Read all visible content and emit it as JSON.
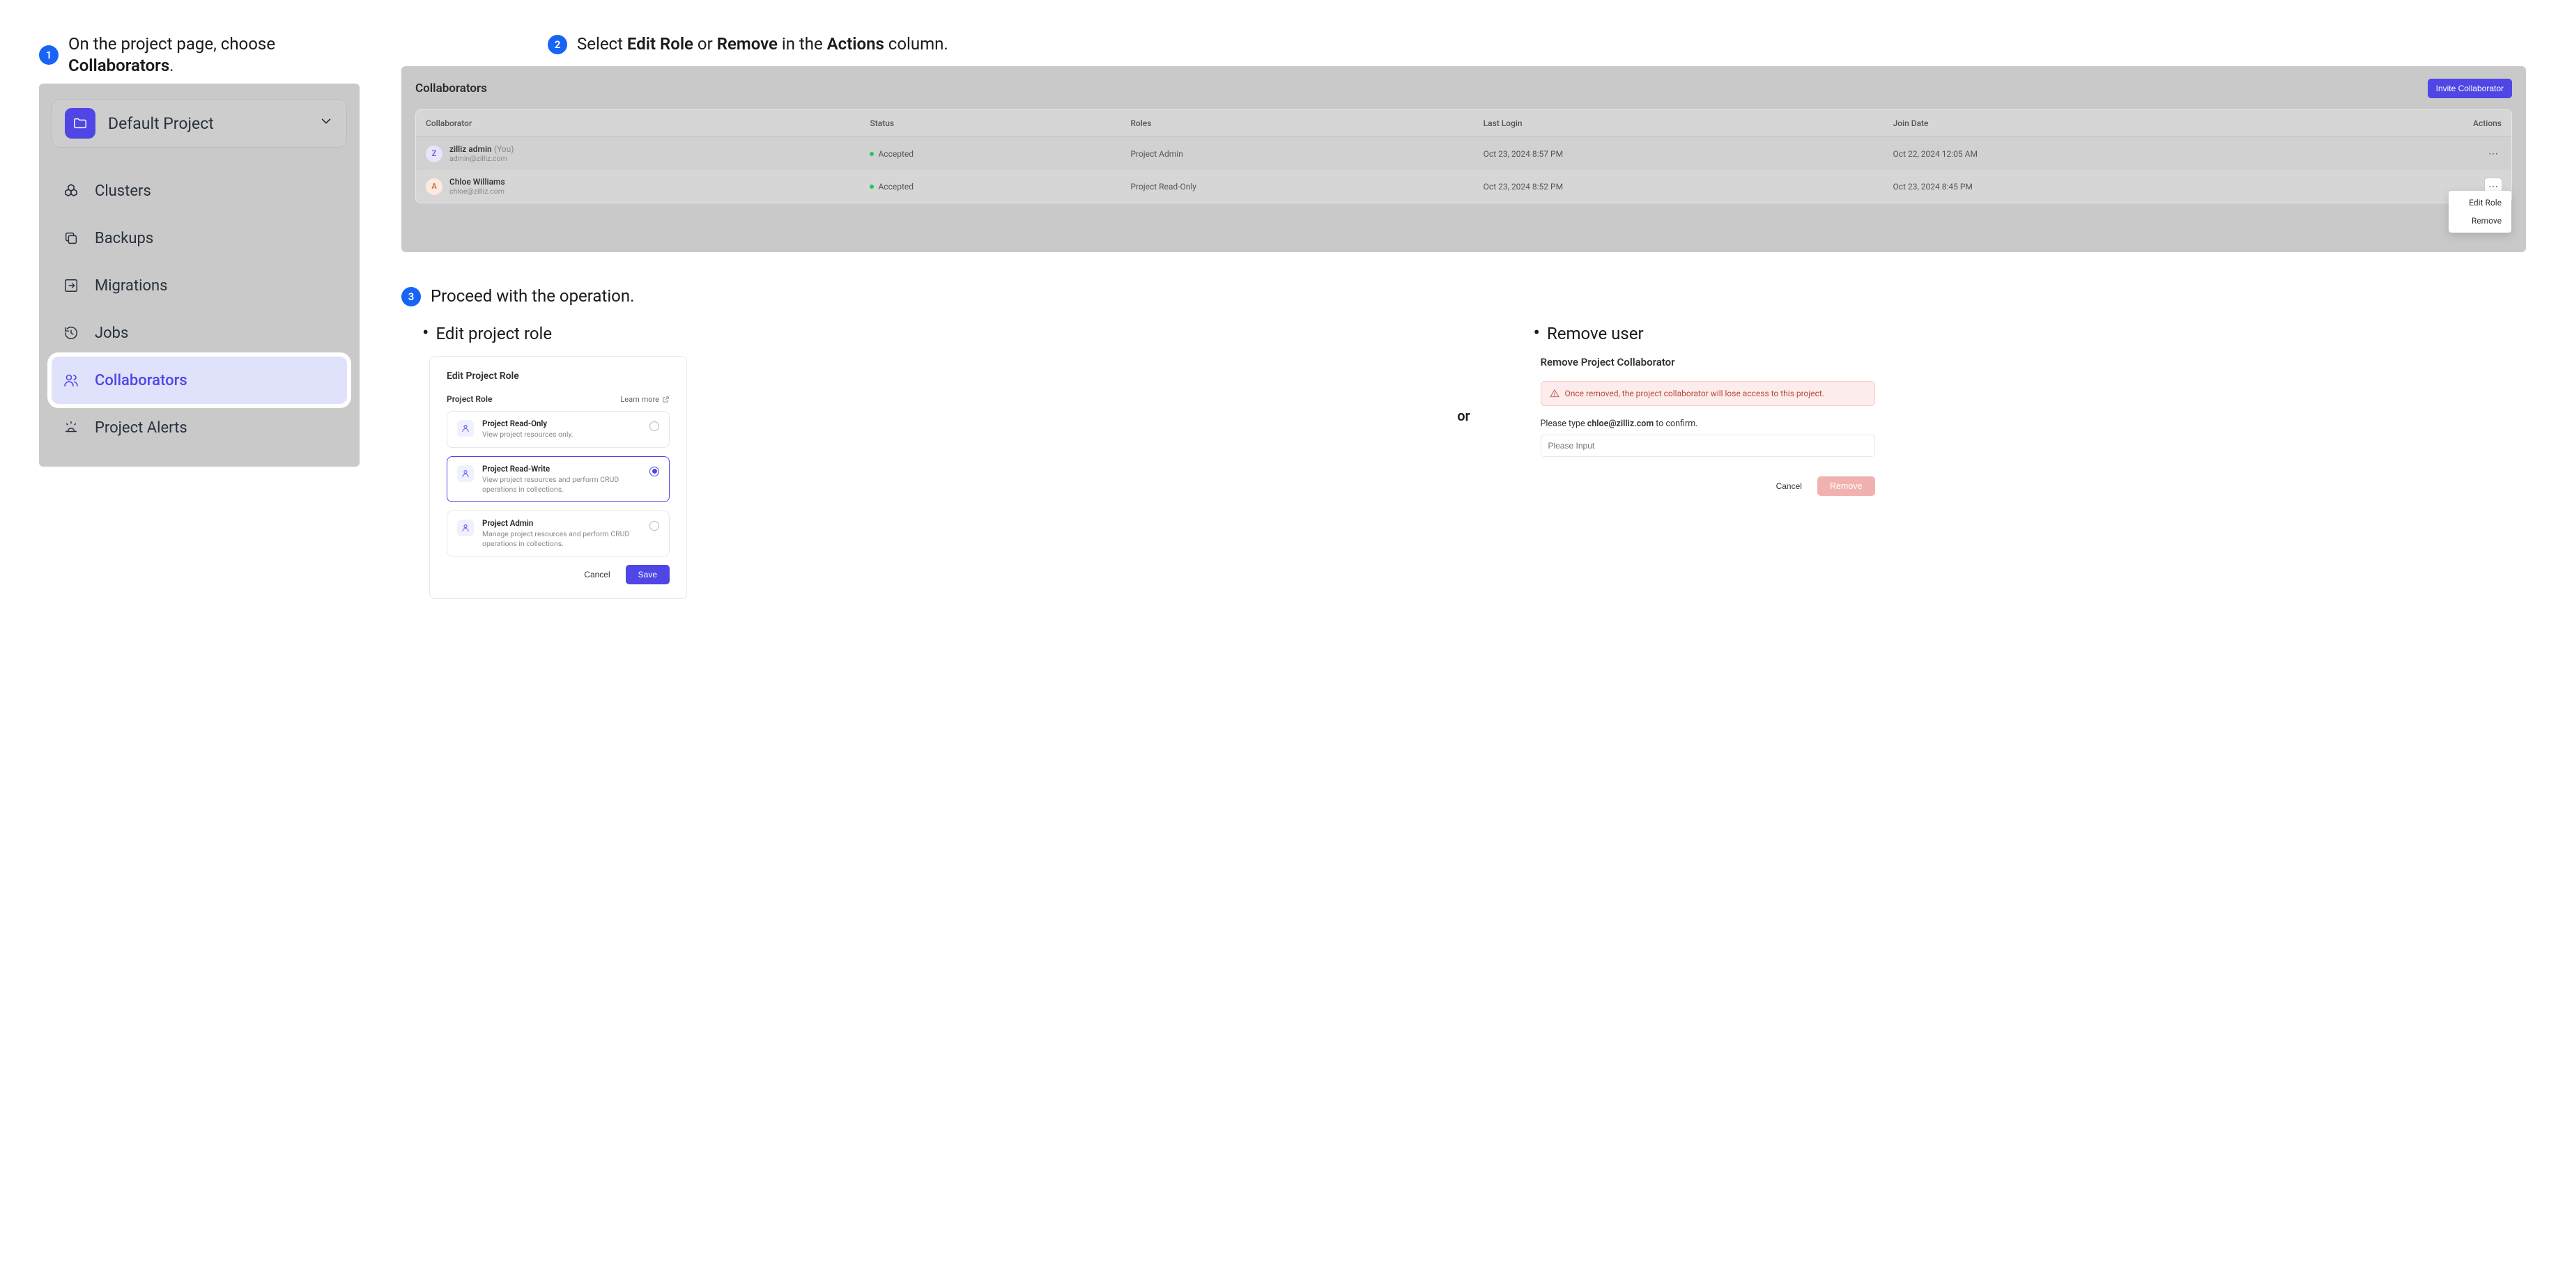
{
  "steps": {
    "s1": {
      "num": "1",
      "pre": "On the project page, choose ",
      "bold": "Collaborators",
      "post": "."
    },
    "s2": {
      "num": "2",
      "pre": "Select ",
      "b1": "Edit Role",
      "mid1": " or ",
      "b2": "Remove",
      "mid2": " in the ",
      "b3": "Actions",
      "post": " column."
    },
    "s3": {
      "num": "3",
      "text": "Proceed with the operation."
    }
  },
  "sidebar": {
    "project_label": "Default Project",
    "items": [
      {
        "label": "Clusters"
      },
      {
        "label": "Backups"
      },
      {
        "label": "Migrations"
      },
      {
        "label": "Jobs"
      },
      {
        "label": "Collaborators"
      },
      {
        "label": "Project Alerts"
      }
    ]
  },
  "collab": {
    "title": "Collaborators",
    "invite_label": "Invite Collaborator",
    "columns": {
      "collaborator": "Collaborator",
      "status": "Status",
      "roles": "Roles",
      "last_login": "Last Login",
      "join_date": "Join Date",
      "actions": "Actions"
    },
    "rows": [
      {
        "avatar_letter": "Z",
        "name": "zilliz admin",
        "you": "(You)",
        "email": "admin@zilliz.com",
        "status": "Accepted",
        "role": "Project Admin",
        "last_login": "Oct 23, 2024 8:57 PM",
        "join_date": "Oct 22, 2024 12:05 AM"
      },
      {
        "avatar_letter": "A",
        "name": "Chloe Williams",
        "you": "",
        "email": "chloe@zilliz.com",
        "status": "Accepted",
        "role": "Project Read-Only",
        "last_login": "Oct 23, 2024 8:52 PM",
        "join_date": "Oct 23, 2024 8:45 PM"
      }
    ],
    "menu": {
      "edit": "Edit Role",
      "remove": "Remove"
    }
  },
  "sub": {
    "edit_bullet": "Edit project role",
    "remove_bullet": "Remove user",
    "or": "or"
  },
  "edit_role": {
    "title": "Edit Project Role",
    "section_label": "Project Role",
    "learn_more": "Learn more",
    "cancel": "Cancel",
    "save": "Save",
    "options": [
      {
        "title": "Project Read-Only",
        "desc": "View project resources only."
      },
      {
        "title": "Project Read-Write",
        "desc": "View project resources and perform CRUD operations in collections."
      },
      {
        "title": "Project Admin",
        "desc": "Manage project resources and perform CRUD operations in collections."
      }
    ]
  },
  "remove": {
    "title": "Remove Project Collaborator",
    "warning": "Once removed, the project collaborator will lose access to this project.",
    "confirm_pre": "Please type ",
    "confirm_email": "chloe@zilliz.com",
    "confirm_post": " to confirm.",
    "placeholder": "Please Input",
    "cancel": "Cancel",
    "remove_btn": "Remove"
  }
}
